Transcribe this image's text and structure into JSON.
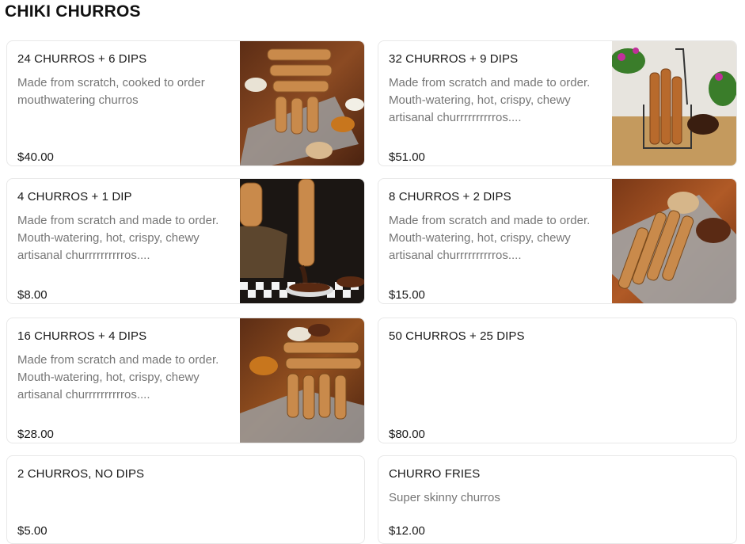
{
  "section": {
    "title": "CHIKI CHURROS"
  },
  "items": [
    {
      "name": "24 CHURROS + 6 DIPS",
      "description": "Made from scratch, cooked to order mouthwatering churros",
      "price": "$40.00",
      "image_icon": "churro-stack-photo"
    },
    {
      "name": "32 CHURROS + 9 DIPS",
      "description": "Made from scratch and made to order. Mouth-watering, hot, crispy, chewy artisanal churrrrrrrrrros....",
      "price": "$51.00",
      "image_icon": "churro-basket-photo"
    },
    {
      "name": "4 CHURROS + 1 DIP",
      "description": "Made from scratch and made to order. Mouth-watering, hot, crispy, chewy artisanal churrrrrrrrrros....",
      "price": "$8.00",
      "image_icon": "churro-dip-photo"
    },
    {
      "name": "8 CHURROS + 2 DIPS",
      "description": "Made from scratch and made to order. Mouth-watering, hot, crispy, chewy artisanal churrrrrrrrrros....",
      "price": "$15.00",
      "image_icon": "churro-tray-photo"
    },
    {
      "name": "16 CHURROS + 4 DIPS",
      "description": "Made from scratch and made to order. Mouth-watering, hot, crispy, chewy artisanal churrrrrrrrrros....",
      "price": "$28.00",
      "image_icon": "churro-stack-photo"
    },
    {
      "name": "50 CHURROS + 25 DIPS",
      "description": "",
      "price": "$80.00",
      "image_icon": ""
    },
    {
      "name": "2 CHURROS, NO DIPS",
      "description": "",
      "price": "$5.00",
      "image_icon": ""
    },
    {
      "name": "CHURRO FRIES",
      "description": "Super skinny churros",
      "price": "$12.00",
      "image_icon": ""
    }
  ],
  "colors": {
    "text_primary": "#191919",
    "text_secondary": "#767676",
    "card_border": "#e8e8e8"
  }
}
